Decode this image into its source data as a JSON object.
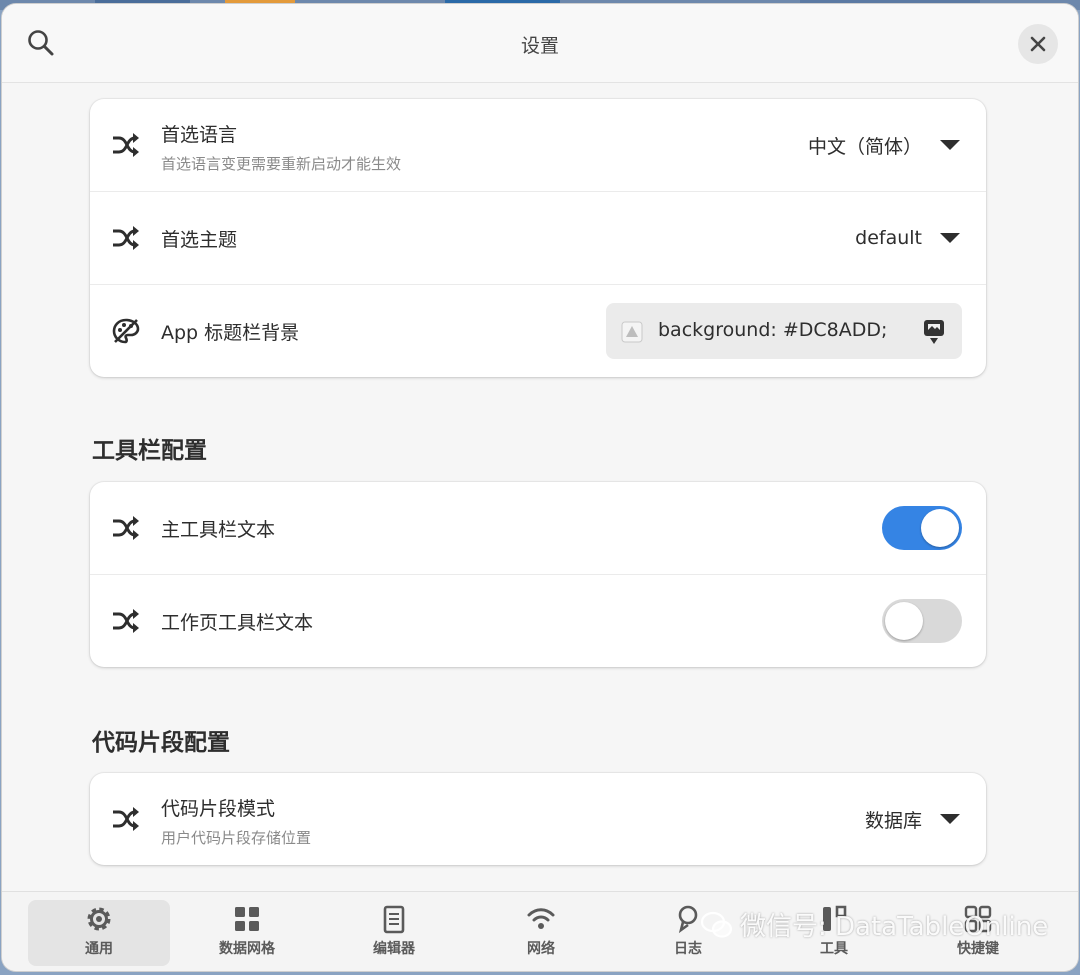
{
  "header": {
    "title": "设置"
  },
  "general_card": {
    "language": {
      "title": "首选语言",
      "subtitle": "首选语言变更需要重新启动才能生效",
      "value": "中文（简体）"
    },
    "theme": {
      "title": "首选主题",
      "value": "default"
    },
    "app_title_bg": {
      "title": "App 标题栏背景",
      "value": "background: #DC8ADD;"
    }
  },
  "toolbar_section": {
    "title": "工具栏配置",
    "main_toolbar_text": {
      "title": "主工具栏文本",
      "enabled": true
    },
    "worksheet_toolbar_text": {
      "title": "工作页工具栏文本",
      "enabled": false
    }
  },
  "snippet_section": {
    "title": "代码片段配置",
    "mode": {
      "title": "代码片段模式",
      "subtitle": "用户代码片段存储位置",
      "value": "数据库"
    }
  },
  "bottom_nav": [
    {
      "label": "通用",
      "icon": "gear-icon",
      "active": true
    },
    {
      "label": "数据网格",
      "icon": "grid-icon",
      "active": false
    },
    {
      "label": "编辑器",
      "icon": "editor-icon",
      "active": false
    },
    {
      "label": "网络",
      "icon": "wifi-icon",
      "active": false
    },
    {
      "label": "日志",
      "icon": "log-icon",
      "active": false
    },
    {
      "label": "工具",
      "icon": "tools-icon",
      "active": false
    },
    {
      "label": "快捷键",
      "icon": "shortcut-icon",
      "active": false
    }
  ],
  "watermark": {
    "text": "微信号: DataTableOnline"
  },
  "colors": {
    "accent": "#3584e4",
    "switch_off": "#d9d9d9",
    "window_bg": "#f6f6f6",
    "card_bg": "#ffffff"
  }
}
